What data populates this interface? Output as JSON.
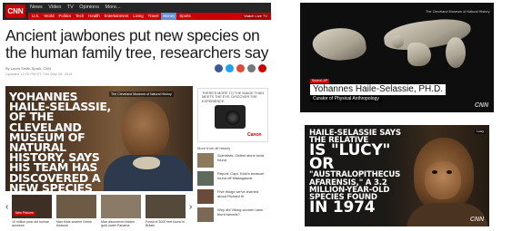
{
  "cnn_page": {
    "logo": "CNN",
    "top_links": [
      "News",
      "Video",
      "TV",
      "Opinions",
      "More..."
    ],
    "nav_items": [
      "U.S.",
      "World",
      "Politics",
      "Tech",
      "Health",
      "Entertainment",
      "Living",
      "Travel",
      "Money",
      "Sports"
    ],
    "nav_active": "Money",
    "subscribe": "Watch Live TV",
    "headline": "Ancient jawbones put new species on the human family tree, researchers say",
    "byline": "By Laura Smith-Spark, CNN",
    "updated": "Updated 12:20 PM ET, Thu May 28, 2015",
    "hero_text": "Yohannes Haile-Selassie, of the Cleveland Museum of Natural History, says his team has discovered a new species of human ancestor",
    "hero_caption": "The Cleveland Museum of Natural History",
    "ad_text": "There's more to the image than meets the eye. Discover the experience.",
    "ad_brand": "Canon",
    "more_stories_header": "More from all history",
    "more_stories": [
      "Scientists: Oldest stone tools found",
      "Report: Capt. Kidd's treasure found off Madagascar",
      "Five things we've learned about Richard III",
      "Why did Viking women have blunt swords?"
    ],
    "strip_tag": "New Pictures",
    "strip": [
      "10 million year-old human ancestor",
      "Man finds ancient Greek treasure",
      "Man discovered hidden gold under Panama",
      "Fossil of 3000 feet found in Britain"
    ]
  },
  "clip_skull": {
    "museum_caption": "The Cleveland Museum of Natural History",
    "tag": "Source: AP",
    "name": "Yohannes Haile-Selassie, PH.D.",
    "title": "Curator of Physical Anthropology",
    "bug": "CNN"
  },
  "clip_lucy": {
    "line1": "Haile-Selassie says the relative",
    "line2": "is \"Lucy\" or",
    "line3": "\"Australopithecus afarensis,\" a 3.2 million-year-old species found",
    "line4": "in 1974",
    "live": "Lucy",
    "bug": "CNN"
  },
  "colors": {
    "cnn_red": "#cc0000",
    "top_bar": "#262626",
    "nav_active": "#5a8fd6"
  }
}
